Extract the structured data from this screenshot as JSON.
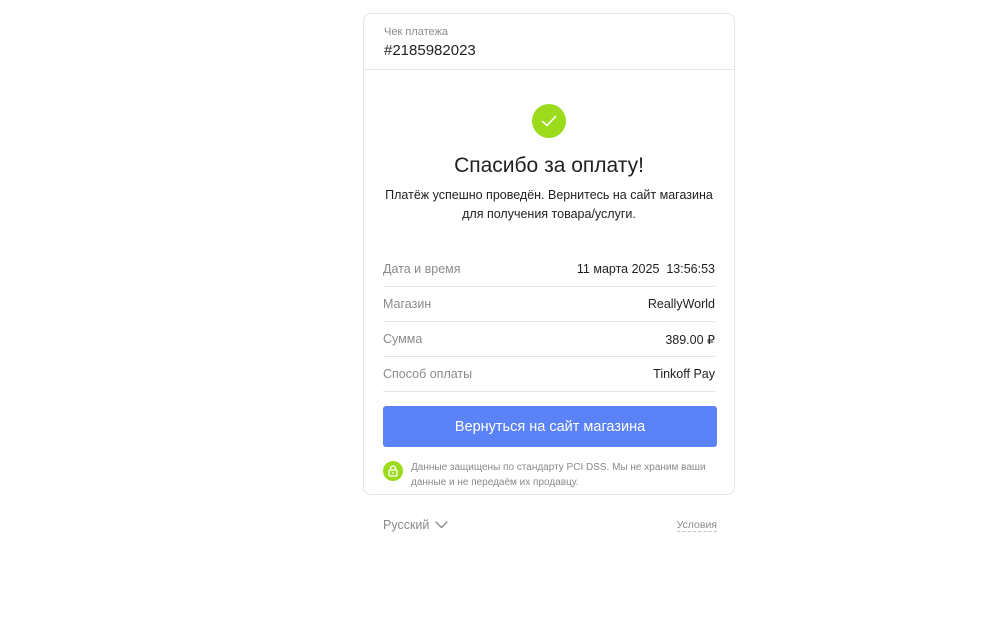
{
  "header": {
    "receipt_label": "Чек платежа",
    "receipt_number": "#2185982023"
  },
  "success": {
    "icon": "check-icon",
    "title": "Спасибо за оплату!",
    "message": "Платёж успешно проведён. Вернитесь на сайт магазина для получения товара/услуги."
  },
  "details": [
    {
      "label": "Дата и время",
      "value": "11 марта 2025  13:56:53"
    },
    {
      "label": "Магазин",
      "value": "ReallyWorld"
    },
    {
      "label": "Сумма",
      "value": "389.00 ₽"
    },
    {
      "label": "Способ оплаты",
      "value": "Tinkoff Pay"
    }
  ],
  "actions": {
    "return_label": "Вернуться на сайт магазина"
  },
  "security": {
    "icon": "lock-icon",
    "text": "Данные защищены по стандарту PCI DSS. Мы не храним ваши данные и не передаём их продавцу."
  },
  "footer": {
    "language": "Русский",
    "terms": "Условия"
  },
  "colors": {
    "accent_green": "#9bdb1c",
    "button_blue": "#5b82f6",
    "muted_text": "#8a8a8a",
    "border": "#e6e6e6"
  }
}
